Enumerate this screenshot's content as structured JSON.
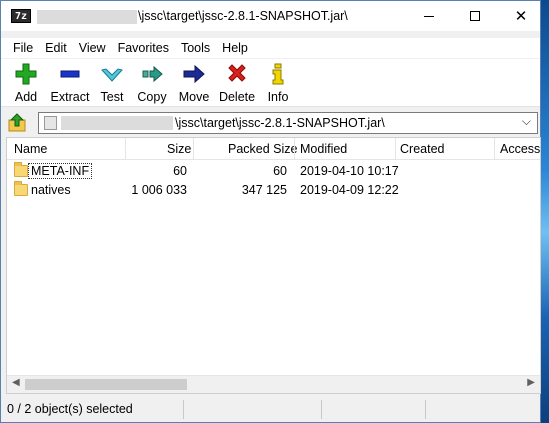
{
  "window": {
    "app_icon_text": "7z",
    "title": "\\jssc\\target\\jssc-2.8.1-SNAPSHOT.jar\\",
    "controls": {
      "minimize": "–",
      "maximize": "□",
      "close": "✕"
    }
  },
  "menu": [
    "File",
    "Edit",
    "View",
    "Favorites",
    "Tools",
    "Help"
  ],
  "toolbar": [
    {
      "label": "Add",
      "icon": "plus-icon",
      "color": "#1f9c1f"
    },
    {
      "label": "Extract",
      "icon": "minus-icon",
      "color": "#1a2fbf"
    },
    {
      "label": "Test",
      "icon": "check-icon",
      "color": "#2bb3c9"
    },
    {
      "label": "Copy",
      "icon": "copy-arrow-icon",
      "color": "#1e8a7a"
    },
    {
      "label": "Move",
      "icon": "move-arrow-icon",
      "color": "#1a2a8f"
    },
    {
      "label": "Delete",
      "icon": "delete-x-icon",
      "color": "#d01818"
    },
    {
      "label": "Info",
      "icon": "info-icon",
      "color": "#e2c900"
    }
  ],
  "address": {
    "path": "\\jssc\\target\\jssc-2.8.1-SNAPSHOT.jar\\",
    "dropdown": "⌵"
  },
  "columns": [
    "Name",
    "Size",
    "Packed Size",
    "Modified",
    "Created",
    "Accesse"
  ],
  "rows": [
    {
      "name": "META-INF",
      "size": "60",
      "packed": "60",
      "modified": "2019-04-10 10:17",
      "created": "",
      "accessed": ""
    },
    {
      "name": "natives",
      "size": "1 006 033",
      "packed": "347 125",
      "modified": "2019-04-09 12:22",
      "created": "",
      "accessed": ""
    }
  ],
  "scrollbar": {
    "left": "◀",
    "right": "▶"
  },
  "status": "0 / 2 object(s) selected"
}
